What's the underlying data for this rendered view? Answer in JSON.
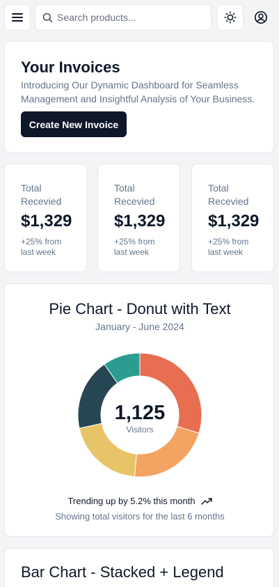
{
  "header": {
    "search_placeholder": "Search products...",
    "menu_icon": "menu-icon",
    "theme_icon": "sun-icon",
    "account_icon": "user-circle-icon"
  },
  "hero": {
    "title": "Your Invoices",
    "description": "Introducing Our Dynamic Dashboard for Seamless Management and Insightful Analysis of Your Business.",
    "button_label": "Create New Invoice"
  },
  "stats": [
    {
      "label": "Total Recevied",
      "value": "$1,329",
      "change": "+25% from last week"
    },
    {
      "label": "Total Recevied",
      "value": "$1,329",
      "change": "+25% from last week"
    },
    {
      "label": "Total Recevied",
      "value": "$1,329",
      "change": "+25% from last week"
    }
  ],
  "pie_card": {
    "title": "Pie Chart - Donut with Text",
    "subtitle": "January - June 2024",
    "center_value": "1,125",
    "center_label": "Visitors",
    "trend_text": "Trending up by 5.2% this month",
    "footer": "Showing total visitors for the last 6 months"
  },
  "bar_card": {
    "title": "Bar Chart - Stacked + Legend"
  },
  "chart_data": {
    "type": "pie",
    "values": [
      275,
      200,
      187,
      173,
      90
    ],
    "colors": [
      "#e76e50",
      "#f4a462",
      "#e8c468",
      "#264753",
      "#2a9d90"
    ],
    "total": 1125
  }
}
